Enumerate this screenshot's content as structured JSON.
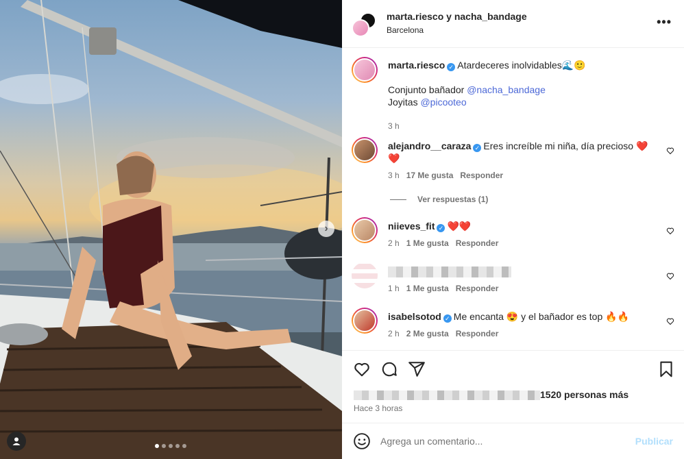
{
  "post": {
    "header": {
      "users": "marta.riesco y nacha_bandage",
      "location": "Barcelona",
      "more_icon": "more-horizontal-icon"
    },
    "image": {
      "description_icon": "photo",
      "slide_count": 5,
      "active_slide": 1
    }
  },
  "caption": {
    "user": "marta.riesco",
    "text": "Atardeceres inolvidables🌊🙂",
    "line2_prefix": "Conjunto bañador ",
    "line2_mention": "@nacha_bandage",
    "line3_prefix": "Joyitas ",
    "line3_mention": "@picooteo",
    "time": "3 h"
  },
  "comments": [
    {
      "user": "alejandro__caraza",
      "verified": true,
      "text": "Eres increíble mi niña, día precioso ❤️❤️",
      "time": "3 h",
      "likes": "17 Me gusta",
      "reply": "Responder",
      "view_replies": "Ver respuestas (1)"
    },
    {
      "user": "niieves_fit",
      "verified": true,
      "text": "❤️❤️",
      "time": "2 h",
      "likes": "1 Me gusta",
      "reply": "Responder"
    },
    {
      "user": "",
      "verified": false,
      "text": "",
      "time": "1 h",
      "likes": "1 Me gusta",
      "reply": "Responder"
    },
    {
      "user": "isabelsotod",
      "verified": true,
      "text": "Me encanta 😍 y el bañador es top 🔥🔥",
      "time": "2 h",
      "likes": "2 Me gusta",
      "reply": "Responder"
    }
  ],
  "actions": {
    "like_icon": "heart-icon",
    "comment_icon": "comment-icon",
    "share_icon": "send-icon",
    "save_icon": "bookmark-icon",
    "likes_text": "1520 personas más",
    "posted": "Hace 3 horas"
  },
  "add_comment": {
    "placeholder": "Agrega un comentario...",
    "post_label": "Publicar"
  },
  "colors": {
    "link": "#4c68d7",
    "verified": "#3897f0",
    "muted": "#737373",
    "publish_disabled": "#b2dffc"
  }
}
